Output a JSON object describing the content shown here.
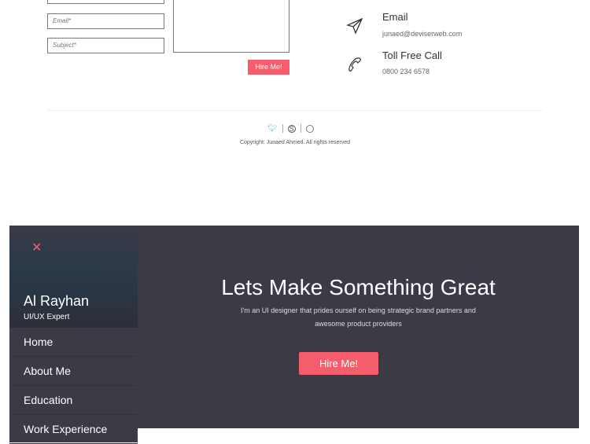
{
  "form": {
    "email_placeholder": "Email*",
    "subject_placeholder": "Subject*",
    "submit_label": "Hire Me!"
  },
  "contact": [
    {
      "icon": "paper-plane-icon",
      "title": "Email",
      "value": "junaed@deviserweb.com"
    },
    {
      "icon": "phone-icon",
      "title": "Toll Free Call",
      "value": "0800 234 6578"
    }
  ],
  "footer": {
    "social": [
      "twitter-icon",
      "skype-icon",
      "dribbble-icon"
    ],
    "copyright": "Copyright: Junaed Ahmed. All rights reserved"
  },
  "sidebar": {
    "name": "Al Rayhan",
    "role": "UI/UX Expert",
    "items": [
      {
        "label": "Home"
      },
      {
        "label": "About Me"
      },
      {
        "label": "Education"
      },
      {
        "label": "Work Experience"
      }
    ]
  },
  "hero": {
    "title": "Lets Make Something Great",
    "subtitle_line1": "I'm an UI designer that prides ourself on being strategic brand partners and",
    "subtitle_line2": "awesome product providers",
    "cta": "Hire Me!"
  },
  "colors": {
    "accent": "#f65d6c",
    "dark": "#3b3a45",
    "twitter": "#4fc3d9"
  }
}
